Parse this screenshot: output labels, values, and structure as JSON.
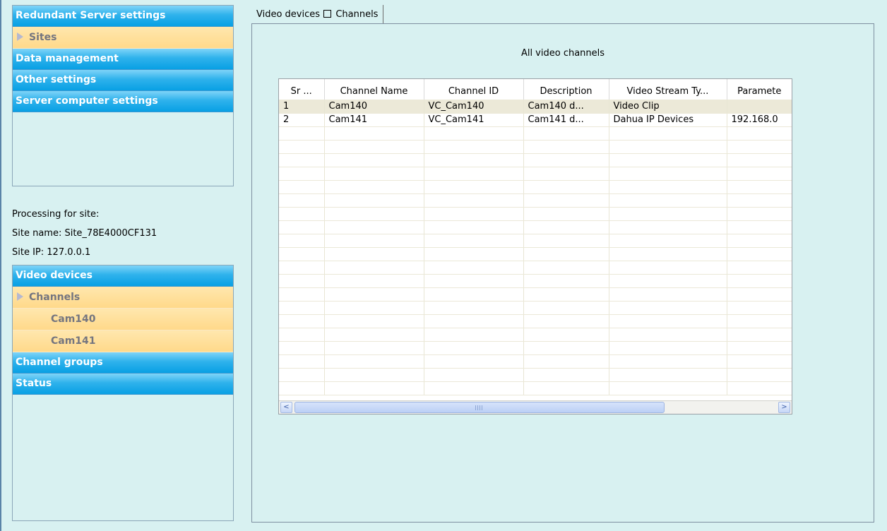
{
  "nav_top": {
    "headers_before": [
      {
        "label": "Redundant Server settings"
      }
    ],
    "active_item": {
      "label": "Sites"
    },
    "headers_after": [
      {
        "label": "Data management"
      },
      {
        "label": "Other settings"
      },
      {
        "label": "Server computer settings"
      }
    ]
  },
  "site": {
    "processing_label": "Processing for site:",
    "name_line": "Site name: Site_78E4000CF131",
    "ip_line": "Site IP: 127.0.0.1"
  },
  "nav_bottom": {
    "header_video": "Video devices",
    "channels_label": "Channels",
    "cameras": [
      "Cam140",
      "Cam141"
    ],
    "header_groups": "Channel groups",
    "header_status": "Status"
  },
  "tab": {
    "part1": "Video devices",
    "part2": "Channels"
  },
  "content": {
    "title": "All video channels"
  },
  "table": {
    "columns": [
      "Sr ...",
      "Channel Name",
      "Channel ID",
      "Description",
      "Video Stream Ty...",
      "Paramete"
    ],
    "rows": [
      [
        "1",
        "Cam140",
        "VC_Cam140",
        "Cam140 d...",
        "Video Clip",
        ""
      ],
      [
        "2",
        "Cam141",
        "VC_Cam141",
        "Cam141 d...",
        "Dahua IP Devices",
        "192.168.0"
      ]
    ],
    "selected_row": 0
  },
  "scrollbar": {
    "left_arrow": "<",
    "right_arrow": ">"
  }
}
